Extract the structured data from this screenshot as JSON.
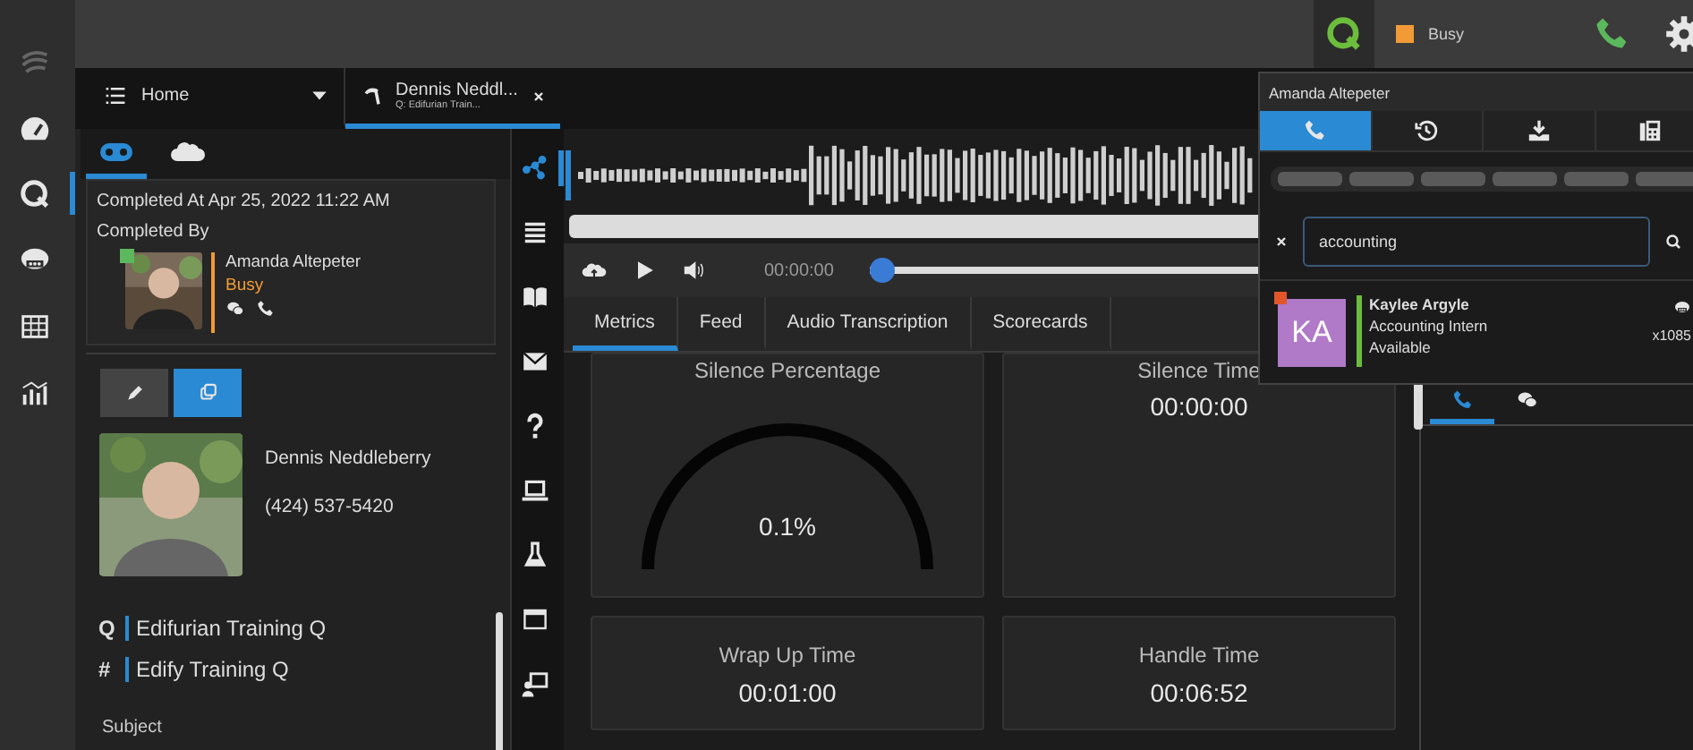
{
  "rail": {
    "items": [
      {
        "selected": false
      },
      {
        "selected": false
      },
      {
        "selected": true
      },
      {
        "selected": false
      },
      {
        "selected": false
      },
      {
        "selected": false
      }
    ]
  },
  "top_bar": {
    "status": {
      "label": "Busy"
    }
  },
  "tabs": [
    {
      "kind": "home",
      "label": "Home",
      "selected": false
    },
    {
      "kind": "call",
      "label": "Dennis Neddl...",
      "sublabel": "Q: Edifurian Train...",
      "selected": true
    }
  ],
  "left_panel": {
    "header_tabs": [
      {
        "selected": true
      },
      {
        "selected": false
      }
    ],
    "completed_at": "Completed At Apr 25, 2022 11:22 AM",
    "completed_by_label": "Completed By",
    "agent": {
      "name": "Amanda Altepeter",
      "status": "Busy"
    },
    "action_buttons": [
      {
        "selected": false
      },
      {
        "selected": true
      }
    ],
    "contact": {
      "name": "Dennis Neddleberry",
      "phone": "(424) 537-5420"
    },
    "queue_rows": [
      {
        "prefix": "Q",
        "label": "Edifurian Training Q"
      },
      {
        "prefix": "#",
        "label": "Edify Training Q"
      }
    ],
    "subject_label": "Subject"
  },
  "tool_column": {
    "items": [
      {
        "selected": true
      },
      {
        "selected": false
      },
      {
        "selected": false
      },
      {
        "selected": false
      },
      {
        "selected": false
      },
      {
        "selected": false
      },
      {
        "selected": false
      },
      {
        "selected": false
      },
      {
        "selected": false
      }
    ]
  },
  "player": {
    "time": "00:00:00",
    "level": 0
  },
  "metric_tabs": [
    {
      "label": "Metrics",
      "selected": true
    },
    {
      "label": "Feed",
      "selected": false
    },
    {
      "label": "Audio Transcription",
      "selected": false
    },
    {
      "label": "Scorecards",
      "selected": false
    }
  ],
  "metrics": [
    {
      "kind": "gauge",
      "title": "Silence Percentage",
      "value": "0.1%"
    },
    {
      "kind": "time",
      "title": "Silence Time",
      "value": "00:00:00"
    },
    {
      "kind": "time",
      "title": "Wrap Up Time",
      "value": "00:01:00"
    },
    {
      "kind": "time",
      "title": "Handle Time",
      "value": "00:06:52"
    }
  ],
  "right_panel": {
    "tabs": [
      {
        "selected": true
      },
      {
        "selected": false
      }
    ]
  },
  "directory_popup": {
    "user": "Amanda Altepeter",
    "tabs": [
      {
        "selected": true
      },
      {
        "selected": false
      },
      {
        "selected": false
      },
      {
        "selected": false
      }
    ],
    "search": {
      "value": "accounting"
    },
    "results": [
      {
        "initials": "KA",
        "name": "Kaylee Argyle",
        "title": "Accounting Intern",
        "status": "Available",
        "extension": "x1085"
      }
    ]
  }
}
